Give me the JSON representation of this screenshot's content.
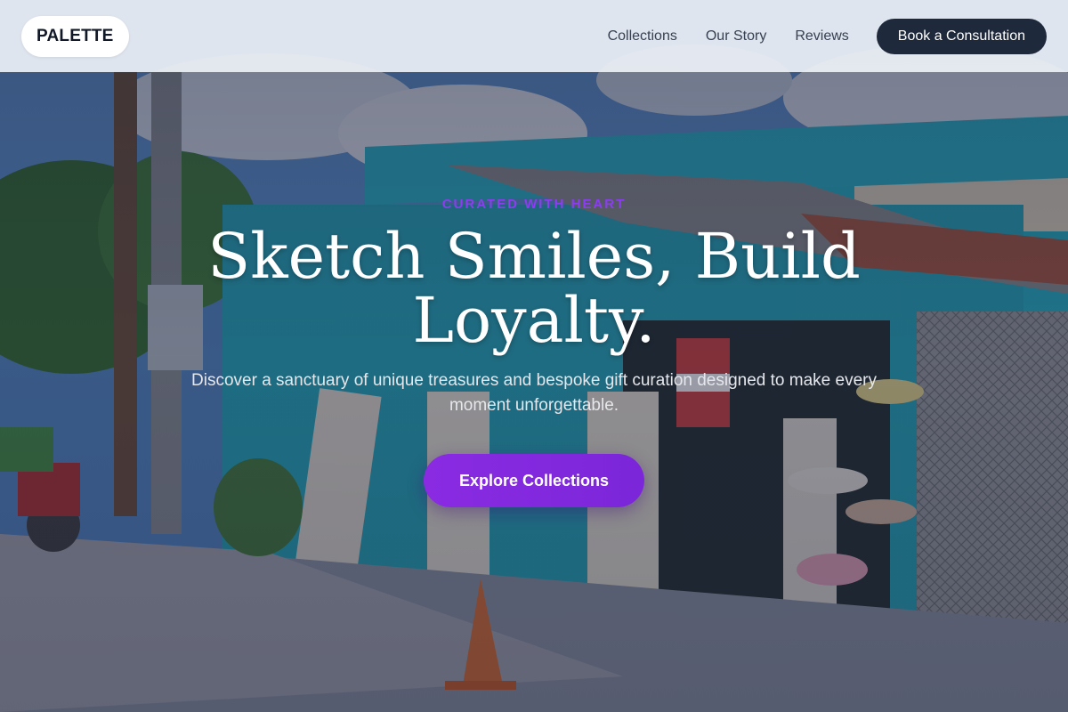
{
  "navbar": {
    "logo_text": "PALETTE",
    "links": [
      {
        "label": "Collections"
      },
      {
        "label": "Our Story"
      },
      {
        "label": "Reviews"
      }
    ],
    "cta_label": "Book a Consultation"
  },
  "hero": {
    "eyebrow": "CURATED WITH HEART",
    "title": "Sketch Smiles, Build Loyalty.",
    "subtitle": "Discover a sanctuary of unique treasures and bespoke gift curation designed to make every moment unforgettable.",
    "cta_label": "Explore Collections"
  },
  "colors": {
    "navbar_bg": "#ECF0F6",
    "dark_button": "#1E293B",
    "accent_purple": "#8A2BE2",
    "eyebrow_purple": "#8B3DF0",
    "shop_teal": "#1FB5C8"
  }
}
